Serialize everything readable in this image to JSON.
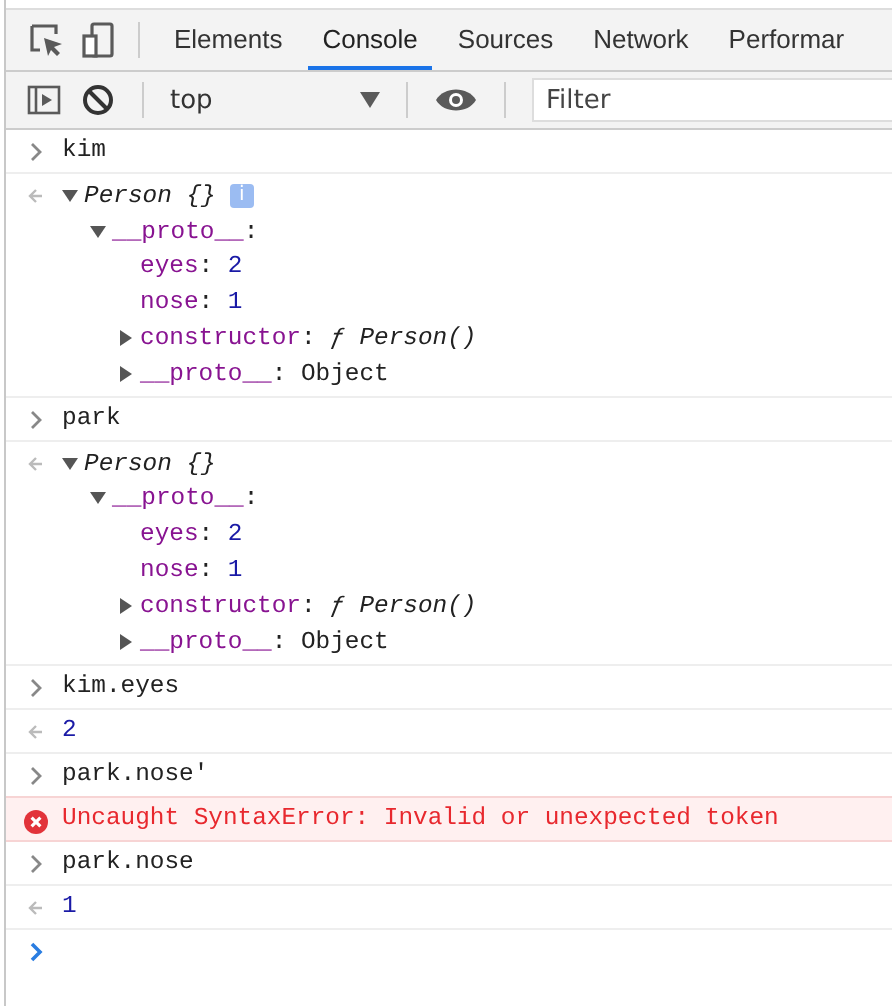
{
  "tabs": [
    {
      "label": "Elements",
      "selected": false
    },
    {
      "label": "Console",
      "selected": true
    },
    {
      "label": "Sources",
      "selected": false
    },
    {
      "label": "Network",
      "selected": false
    },
    {
      "label": "Performar",
      "selected": false
    }
  ],
  "toolbar": {
    "context": "top",
    "filter": {
      "placeholder": "Filter"
    }
  },
  "entries": [
    {
      "kind": "input",
      "text": "kim"
    },
    {
      "kind": "object",
      "label": "Person {}",
      "badge": "i",
      "expanded": true,
      "children": [
        {
          "key": "__proto__",
          "sep": ":",
          "expanded": true,
          "children": [
            {
              "key": "eyes",
              "sep": ":",
              "value": "2",
              "kind": "number"
            },
            {
              "key": "nose",
              "sep": ":",
              "value": "1",
              "kind": "number"
            },
            {
              "key": "constructor",
              "sep": ":",
              "expanded": false,
              "value": "ƒ Person()",
              "kind": "function"
            },
            {
              "key": "__proto__",
              "sep": ":",
              "expanded": false,
              "value": "Object",
              "kind": "plain"
            }
          ]
        }
      ]
    },
    {
      "kind": "input",
      "text": "park"
    },
    {
      "kind": "object",
      "label": "Person {}",
      "expanded": true,
      "children": [
        {
          "key": "__proto__",
          "sep": ":",
          "expanded": true,
          "children": [
            {
              "key": "eyes",
              "sep": ":",
              "value": "2",
              "kind": "number"
            },
            {
              "key": "nose",
              "sep": ":",
              "value": "1",
              "kind": "number"
            },
            {
              "key": "constructor",
              "sep": ":",
              "expanded": false,
              "value": "ƒ Person()",
              "kind": "function"
            },
            {
              "key": "__proto__",
              "sep": ":",
              "expanded": false,
              "value": "Object",
              "kind": "plain"
            }
          ]
        }
      ]
    },
    {
      "kind": "input",
      "text": "kim.eyes"
    },
    {
      "kind": "result",
      "text": "2"
    },
    {
      "kind": "input",
      "text": "park.nose'"
    },
    {
      "kind": "error",
      "text": "Uncaught SyntaxError: Invalid or unexpected token"
    },
    {
      "kind": "input",
      "text": "park.nose"
    },
    {
      "kind": "result",
      "text": "1"
    },
    {
      "kind": "prompt"
    }
  ]
}
